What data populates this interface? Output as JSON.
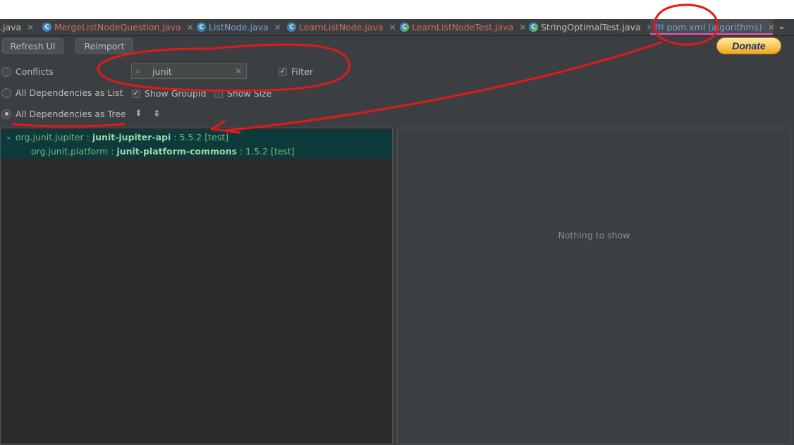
{
  "tabs": [
    {
      "label": ".java",
      "style": "norm",
      "icon": ""
    },
    {
      "label": "MergeListNodeQuestion.java",
      "style": "err",
      "icon": "class-icon"
    },
    {
      "label": "ListNode.java",
      "style": "sel",
      "icon": "class-icon"
    },
    {
      "label": "LearnListNode.java",
      "style": "err",
      "icon": "class-icon"
    },
    {
      "label": "LearnListNodeTest.java",
      "style": "err",
      "icon": "test-class-icon"
    },
    {
      "label": "StringOptimalTest.java",
      "style": "norm",
      "icon": "test-class-icon"
    },
    {
      "label": "pom.xml (algorithms)",
      "style": "sel",
      "icon": "maven-icon"
    }
  ],
  "icons": {
    "class": "C",
    "maven": "m",
    "close": "✕",
    "more": "⌄",
    "search": "⌕",
    "chevron": "⌄",
    "expand": "⇞",
    "collapse": "⇟",
    "check": "✓"
  },
  "toolbar": {
    "refresh_label": "Refresh UI",
    "reimport_label": "Reimport",
    "donate_label": "Donate"
  },
  "options": {
    "conflicts_label": "Conflicts",
    "list_label": "All Dependencies as List",
    "tree_label": "All Dependencies as Tree",
    "selected": "tree"
  },
  "search": {
    "value": "junit",
    "placeholder": ""
  },
  "filter": {
    "label": "Filter",
    "checked": true
  },
  "show_groupid": {
    "label": "Show GroupId",
    "checked": true
  },
  "show_size": {
    "label": "Show Size",
    "checked": false
  },
  "tree": [
    {
      "group": "org.junit.jupiter",
      "artifact": "junit-jupiter-api",
      "version": "5.5.2 [test]",
      "expanded": true,
      "depth": 0
    },
    {
      "group": "org.junit.platform",
      "artifact": "junit-platform-commons",
      "version": "1.5.2 [test]",
      "expanded": false,
      "depth": 1
    }
  ],
  "details": {
    "empty_text": "Nothing to show"
  },
  "colors": {
    "annotation": "#e01a1a",
    "accent_tab": "#c3569b",
    "tree_selected": "#0d3a3a"
  }
}
